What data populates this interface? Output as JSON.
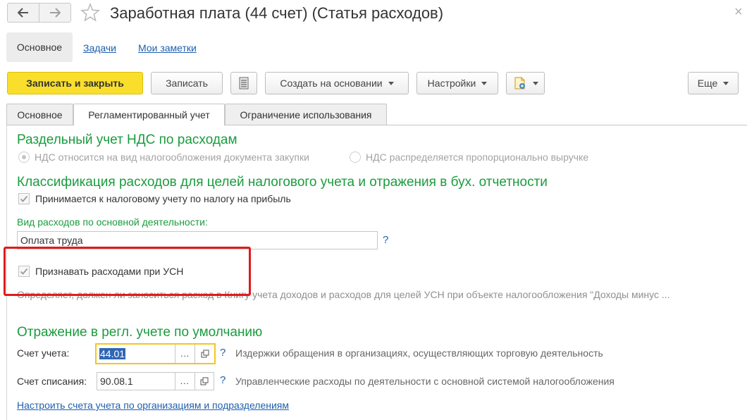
{
  "window": {
    "title": "Заработная плата (44 счет) (Статья расходов)",
    "close_glyph": "×"
  },
  "icons": {
    "back": "arrow-left-icon",
    "forward": "arrow-right-icon",
    "favorite": "star-icon",
    "list": "list-icon",
    "attach": "document-clip-icon",
    "close": "close-icon"
  },
  "colors": {
    "primary_button": "#f9df2b",
    "section_title": "#1a9c3e",
    "link": "#1f5fae",
    "highlight_frame": "#e11b1b",
    "focus_frame": "#f4c51e"
  },
  "panel_tabs": {
    "main": "Основное",
    "tasks": "Задачи",
    "notes": "Мои заметки"
  },
  "toolbar": {
    "save_close": "Записать и закрыть",
    "save": "Записать",
    "create_based": "Создать на основании",
    "settings": "Настройки",
    "more": "Еще"
  },
  "form_tabs": {
    "main": "Основное",
    "regulated": "Регламентированный учет",
    "restriction": "Ограничение использования"
  },
  "vat": {
    "title": "Раздельный учет НДС по расходам",
    "option1": "НДС относится на вид налогообложения документа закупки",
    "option2": "НДС распределяется пропорционально выручке"
  },
  "classification": {
    "title": "Классификация расходов для целей налогового учета и отражения в бух. отчетности",
    "profit_tax_check": "Принимается к налоговому учету по налогу на прибыль",
    "expense_type_label": "Вид расходов по основной деятельности:",
    "expense_type_value": "Оплата труда",
    "usn_check": "Признавать расходами при УСН",
    "usn_desc": "Определяет, должен ли заноситься расход в Книгу учета доходов и расходов для целей УСН при объекте налогообложения \"Доходы минус ..."
  },
  "accounting": {
    "title": "Отражение в регл. учете по умолчанию",
    "account_label": "Счет учета:",
    "account_value": "44.01",
    "account_desc": "Издержки обращения в организациях, осуществляющих торговую деятельность",
    "writeoff_label": "Счет списания:",
    "writeoff_value": "90.08.1",
    "writeoff_desc": "Управленческие расходы по деятельности с основной системой налогообложения",
    "configure_link": "Настроить счета учета по организациям и подразделениям"
  },
  "common": {
    "help": "?",
    "select": "..."
  }
}
